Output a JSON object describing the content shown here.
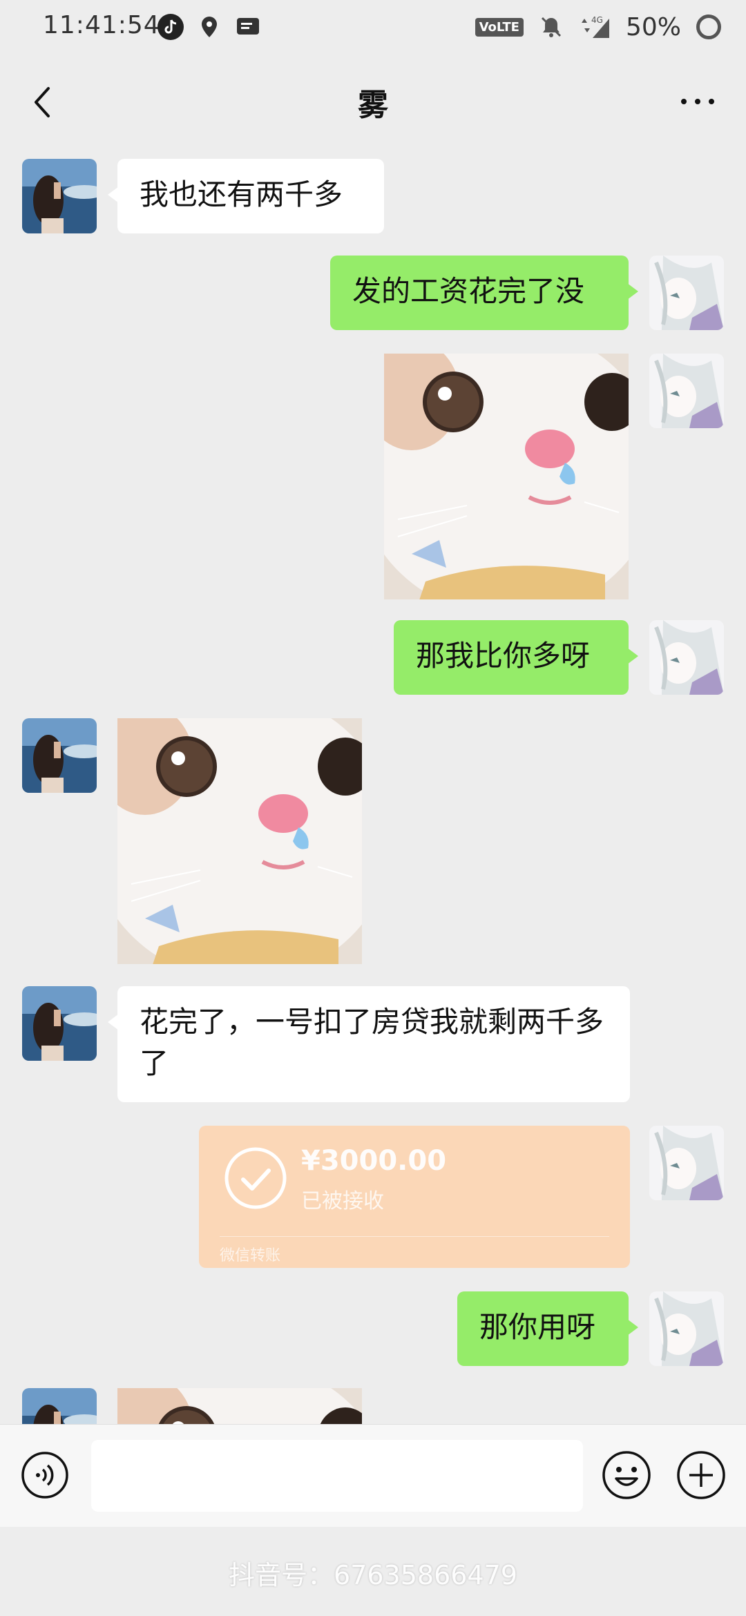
{
  "status_bar": {
    "time": "11:41:54",
    "network_badge": "VoLTE",
    "network_type": "4G",
    "battery": "50%"
  },
  "header": {
    "title": "雾"
  },
  "messages": [
    {
      "side": "left",
      "type": "text",
      "text": "我也还有两千多"
    },
    {
      "side": "right",
      "type": "text",
      "text": "发的工资花完了没"
    },
    {
      "side": "right",
      "type": "sticker",
      "sticker": "crying-cat"
    },
    {
      "side": "right",
      "type": "text",
      "text": "那我比你多呀"
    },
    {
      "side": "left",
      "type": "sticker",
      "sticker": "crying-cat"
    },
    {
      "side": "left",
      "type": "text",
      "text": "花完了，一号扣了房贷我就剩两千多了"
    },
    {
      "side": "right",
      "type": "transfer",
      "amount": "¥3000.00",
      "status": "已被接收",
      "footer": "微信转账"
    },
    {
      "side": "right",
      "type": "text",
      "text": "那你用呀"
    },
    {
      "side": "left",
      "type": "sticker",
      "sticker": "crying-cat"
    }
  ],
  "input_bar": {
    "placeholder": ""
  },
  "watermark": "抖音号：67635866479",
  "colors": {
    "background": "#ededed",
    "self_bubble": "#95ec69",
    "other_bubble": "#ffffff",
    "transfer_card": "#fbd7b7"
  },
  "icons": [
    "back-icon",
    "more-icon",
    "voice-icon",
    "emoji-icon",
    "plus-icon"
  ]
}
